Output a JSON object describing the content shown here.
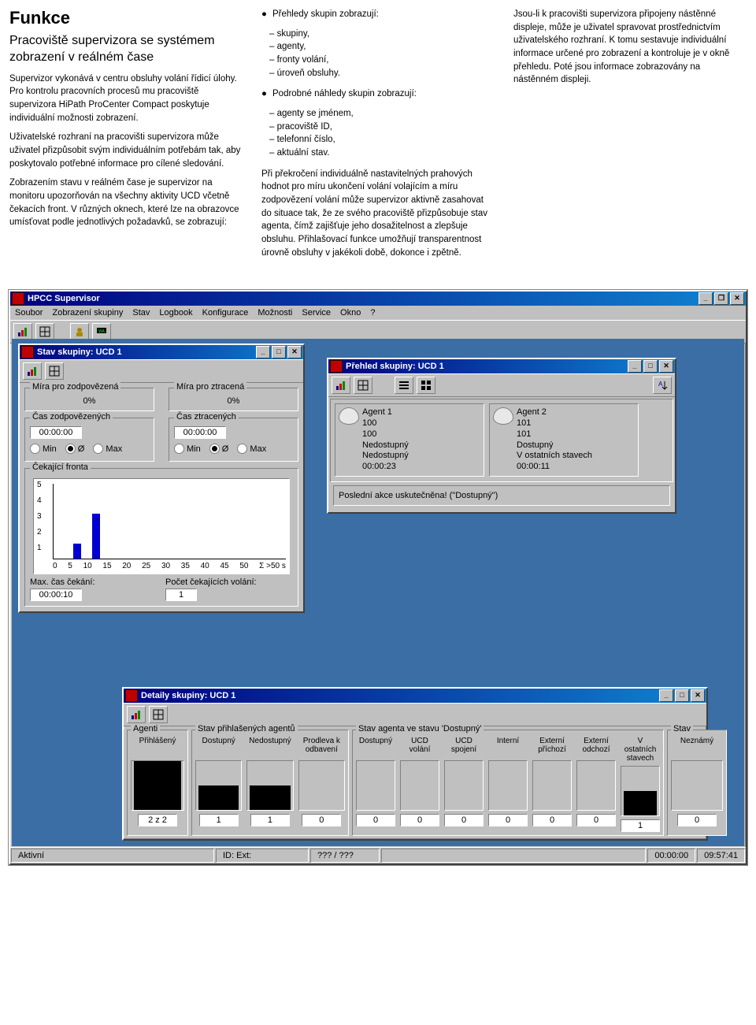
{
  "doc": {
    "h2": "Funkce",
    "h3": "Pracoviště supervizora se systémem zobrazení v reálném čase",
    "p1": "Supervizor vykonává v centru obsluhy volání řídicí úlohy. Pro kontrolu pracovních procesů mu pracoviště supervizora HiPath ProCenter Compact poskytuje individuální možnosti zobrazení.",
    "p2": "Uživatelské rozhraní na pracovišti supervizora může uživatel přizpůsobit svým individuálním potřebám tak, aby poskytovalo potřebné informace pro cílené sledování.",
    "p3": "Zobrazením stavu v reálném čase je supervizor na monitoru upozorňován na všechny aktivity UCD včetně čekacích front. V různých oknech, které lze na obrazovce umísťovat podle jednotlivých požadavků, se zobrazují:",
    "col2_b1": "Přehledy skupin zobrazují:",
    "col2_b1_items": [
      "skupiny,",
      "agenty,",
      "fronty volání,",
      "úroveň obsluhy."
    ],
    "col2_b2": "Podrobné náhledy skupin zobrazují:",
    "col2_b2_items": [
      "agenty se jménem,",
      "pracoviště ID,",
      "telefonní číslo,",
      "aktuální stav."
    ],
    "col2_p": "Při překročení individuálně nastavitelných prahových hodnot pro míru ukončení volání volajícím a míru zodpovězení volání může supervizor aktivně zasahovat do situace tak, že ze svého pracoviště přizpůsobuje stav agenta, čímž zajišťuje jeho dosažitelnost a zlepšuje obsluhu. Přihlašovací funkce umožňují transparentnost úrovně obsluhy v jakékoli době, dokonce i zpětně.",
    "col3_p": "Jsou-li k pracovišti supervizora připojeny nástěnné displeje, může je uživatel spravovat prostřednictvím uživatelského rozhraní. K tomu sestavuje individuální informace určené pro zobrazení a kontroluje je v okně přehledu. Poté jsou informace zobrazovány na nástěnném displeji."
  },
  "app": {
    "title": "HPCC Supervisor",
    "menu": [
      "Soubor",
      "Zobrazení skupiny",
      "Stav",
      "Logbook",
      "Konfigurace",
      "Možnosti",
      "Service",
      "Okno",
      "?"
    ]
  },
  "status": {
    "left": "Aktivní",
    "id": "ID:  Ext:",
    "mid": "??? / ???",
    "t1": "00:00:00",
    "t2": "09:57:41"
  },
  "winStatus": {
    "title": "Stav skupiny: UCD 1",
    "miraZodp": "Míra pro zodpovězená",
    "miraZtr": "Míra pro ztracená",
    "miraZodpVal": "0%",
    "miraZtrVal": "0%",
    "casZodp": "Čas zodpovězených",
    "casZtr": "Čas ztracených",
    "casZodpVal": "00:00:00",
    "casZtrVal": "00:00:00",
    "radioMin": "Min",
    "radioAvg": "Ø",
    "radioMax": "Max",
    "cekajici": "Čekající fronta",
    "maxCas": "Max. čas čekání:",
    "maxCasVal": "00:00:10",
    "pocet": "Počet čekajících volání:",
    "pocetVal": "1"
  },
  "chart_data": {
    "type": "bar",
    "categories": [
      "0",
      "5",
      "10",
      "15",
      "20",
      "25",
      "30",
      "35",
      "40",
      "45",
      "50",
      "Σ >50 s"
    ],
    "values": [
      0,
      1,
      3,
      0,
      0,
      0,
      0,
      0,
      0,
      0,
      0,
      0
    ],
    "ylim": [
      0,
      5
    ],
    "yticks": [
      1,
      2,
      3,
      4,
      5
    ]
  },
  "winPrehled": {
    "title": "Přehled skupiny: UCD 1",
    "agents": [
      {
        "name": "Agent 1",
        "ext": "100",
        "tel": "100",
        "state": "Nedostupný",
        "sub": "Nedostupný",
        "time": "00:00:23"
      },
      {
        "name": "Agent 2",
        "ext": "101",
        "tel": "101",
        "state": "Dostupný",
        "sub": "V ostatních stavech",
        "time": "00:00:11"
      }
    ],
    "lastAction": "Poslední akce uskutečněna! (\"Dostupný\")"
  },
  "winDetail": {
    "title": "Detaily skupiny: UCD 1",
    "groups": {
      "agenti": "Agenti",
      "agentiCol": "Přihlášený",
      "stavPrihl": "Stav přihlašených agentů",
      "stavAgenta": "Stav agenta ve stavu 'Dostupný'",
      "stav": "Stav"
    },
    "cols": [
      {
        "label": "Přihlášený",
        "val": "2 z 2",
        "fill": 100
      },
      {
        "label": "Dostupný",
        "val": "1",
        "fill": 50
      },
      {
        "label": "Nedostupný",
        "val": "1",
        "fill": 50
      },
      {
        "label": "Prodleva k odbavení",
        "val": "0",
        "fill": 0
      },
      {
        "label": "Dostupný",
        "val": "0",
        "fill": 0
      },
      {
        "label": "UCD volání",
        "val": "0",
        "fill": 0
      },
      {
        "label": "UCD spojení",
        "val": "0",
        "fill": 0
      },
      {
        "label": "Interní",
        "val": "0",
        "fill": 0
      },
      {
        "label": "Externí příchozí",
        "val": "0",
        "fill": 0
      },
      {
        "label": "Externí odchozí",
        "val": "0",
        "fill": 0
      },
      {
        "label": "V ostatních stavech",
        "val": "1",
        "fill": 50
      },
      {
        "label": "Neznámý",
        "val": "0",
        "fill": 0
      }
    ]
  },
  "wbtn": {
    "min": "_",
    "max": "□",
    "restore": "❐",
    "close": "✕"
  }
}
